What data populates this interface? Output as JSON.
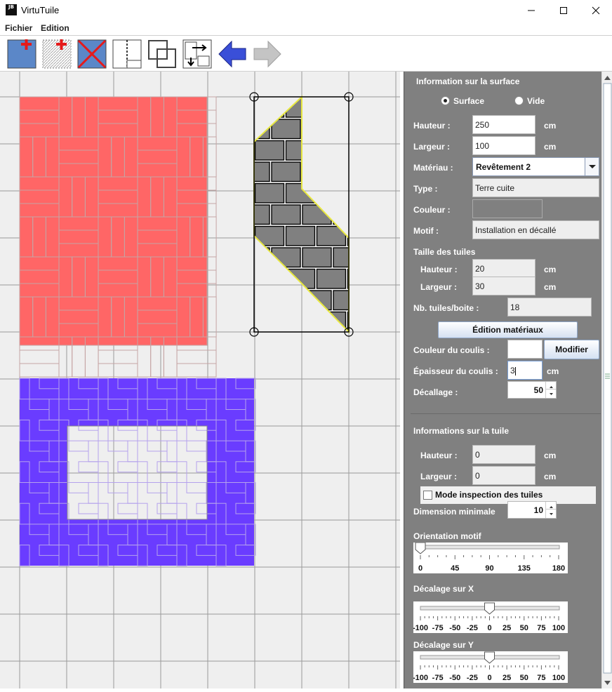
{
  "window": {
    "title": "VirtuTuile",
    "logo": "JB",
    "controls": [
      "minimize-icon",
      "maximize-icon",
      "close-icon"
    ]
  },
  "menu": [
    "Fichier",
    "Edition"
  ],
  "toolbar": {
    "tools": [
      {
        "name": "add-surface-tool",
        "icon": "add-surface-icon"
      },
      {
        "name": "add-void-tool",
        "icon": "add-void-icon"
      },
      {
        "name": "delete-tool",
        "icon": "delete-icon"
      },
      {
        "name": "split-tool",
        "icon": "split-icon"
      },
      {
        "name": "merge-tool",
        "icon": "merge-icon"
      },
      {
        "name": "align-tool",
        "icon": "align-icon"
      },
      {
        "name": "undo-tool",
        "icon": "undo-arrow-icon"
      },
      {
        "name": "redo-tool",
        "icon": "redo-arrow-icon",
        "disabled": true
      }
    ]
  },
  "canvas": {
    "background": "#efefef",
    "grid_color": "#9a9a9a",
    "shapes": [
      {
        "name": "red-surface",
        "color": "#ff6666",
        "pattern": "basketweave"
      },
      {
        "name": "selected-gray-surface",
        "color": "#808080",
        "pattern": "offset-bricks",
        "selected": true,
        "outline_color": "#e8e840"
      },
      {
        "name": "blue-surface",
        "color": "#6a3cff",
        "pattern": "herringbone",
        "has_void": true
      }
    ]
  },
  "panel": {
    "surface_section_title": "Information sur la surface",
    "radio_surface": "Surface",
    "radio_void": "Vide",
    "selected_radio": "Surface",
    "height_label": "Hauteur :",
    "height_value": "250",
    "width_label": "Largeur :",
    "width_value": "100",
    "unit": "cm",
    "material_label": "Matériau :",
    "material_value": "Revêtement 2",
    "type_label": "Type :",
    "type_value": "Terre cuite",
    "color_label": "Couleur :",
    "color_value": "#808080",
    "pattern_label": "Motif :",
    "pattern_value": "Installation en décallé",
    "tile_size_title": "Taille des tuiles",
    "tile_height_label": "Hauteur :",
    "tile_height_value": "20",
    "tile_width_label": "Largeur :",
    "tile_width_value": "30",
    "tiles_per_box_label": "Nb. tuiles/boite :",
    "tiles_per_box_value": "18",
    "edit_materials_button": "Édition matériaux",
    "grout_color_label": "Couleur du coulis :",
    "grout_color_value": "#ffffff",
    "modify_button": "Modifier",
    "grout_thickness_label": "Épaisseur du coulis :",
    "grout_thickness_value": "3",
    "offset_label": "Décallage :",
    "offset_value": "50",
    "tile_info_title": "Informations sur la tuile",
    "tile_info_height_label": "Hauteur :",
    "tile_info_height_value": "0",
    "tile_info_width_label": "Largeur :",
    "tile_info_width_value": "0",
    "inspection_mode_label": "Mode inspection des tuiles",
    "inspection_mode_checked": false,
    "min_dimension_label": "Dimension minimale",
    "min_dimension_value": "10",
    "orientation_title": "Orientation motif",
    "orientation_value": 0,
    "orientation_ticks": [
      "0",
      "45",
      "90",
      "135",
      "180"
    ],
    "shift_x_title": "Décalage sur X",
    "shift_x_value": 0,
    "shift_y_title": "Décalage sur Y",
    "shift_y_value": 0,
    "shift_ticks": [
      "-100",
      "-75",
      "-50",
      "-25",
      "0",
      "25",
      "50",
      "75",
      "100"
    ]
  }
}
